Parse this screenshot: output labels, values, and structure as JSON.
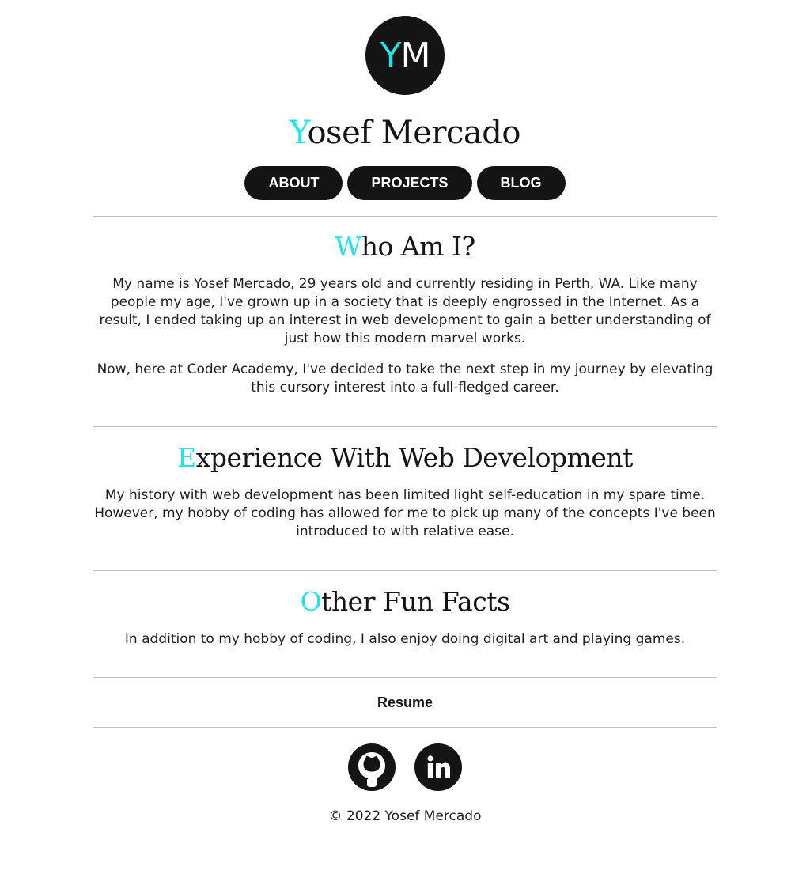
{
  "brand": {
    "logo_initial_accent": "Y",
    "logo_initial_rest": "M",
    "name_first_letter": "Y",
    "name_rest": "osef Mercado",
    "accent_color": "#22e3ea",
    "dark_color": "#141414"
  },
  "nav": {
    "items": [
      {
        "label": "ABOUT"
      },
      {
        "label": "PROJECTS"
      },
      {
        "label": "BLOG"
      }
    ]
  },
  "sections": [
    {
      "title_first": "W",
      "title_rest": "ho Am I?",
      "paragraphs": [
        "My name is Yosef Mercado, 29 years old and currently residing in Perth, WA. Like many people my age, I've grown up in a society that is deeply engrossed in the Internet. As a result, I ended taking up an interest in web development to gain a better understanding of just how this modern marvel works.",
        "Now, here at Coder Academy, I've decided to take the next step in my journey by elevating this cursory interest into a full-fledged career."
      ]
    },
    {
      "title_first": "E",
      "title_rest": "xperience With Web Development",
      "paragraphs": [
        "My history with web development has been limited light self-education in my spare time. However, my hobby of coding has allowed for me to pick up many of the concepts I've been introduced to with relative ease."
      ]
    },
    {
      "title_first": "O",
      "title_rest": "ther Fun Facts",
      "paragraphs": [
        "In addition to my hobby of coding, I also enjoy doing digital art and playing games."
      ]
    }
  ],
  "resume": {
    "label": "Resume"
  },
  "socials": [
    {
      "icon": "github-icon"
    },
    {
      "icon": "linkedin-icon"
    }
  ],
  "footer": {
    "copyright": "© 2022 Yosef Mercado"
  }
}
